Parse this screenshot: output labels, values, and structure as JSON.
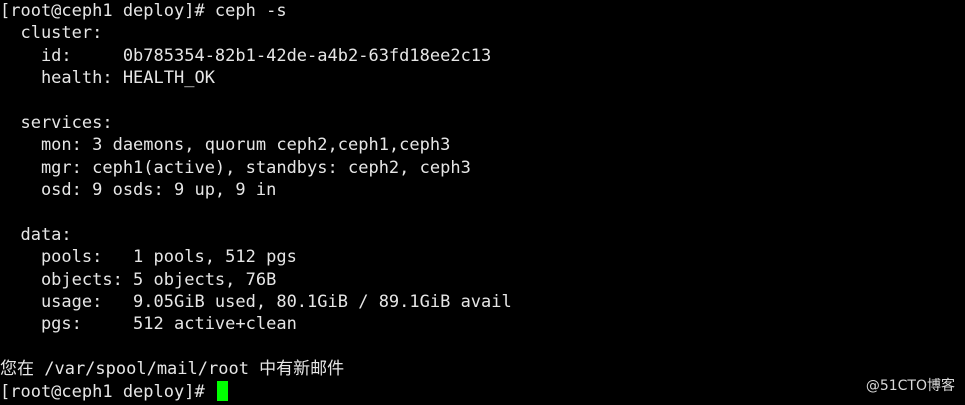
{
  "terminal": {
    "prompt_cmd": "[root@ceph1 deploy]# ceph -s",
    "cluster_header": "  cluster:",
    "cluster_id": "    id:     0b785354-82b1-42de-a4b2-63fd18ee2c13",
    "cluster_health": "    health: HEALTH_OK",
    "services_header": "  services:",
    "services_mon": "    mon: 3 daemons, quorum ceph2,ceph1,ceph3",
    "services_mgr": "    mgr: ceph1(active), standbys: ceph2, ceph3",
    "services_osd": "    osd: 9 osds: 9 up, 9 in",
    "data_header": "  data:",
    "data_pools": "    pools:   1 pools, 512 pgs",
    "data_objects": "    objects: 5 objects, 76B",
    "data_usage": "    usage:   9.05GiB used, 80.1GiB / 89.1GiB avail",
    "data_pgs": "    pgs:     512 active+clean",
    "mail_notice": "您在 /var/spool/mail/root 中有新邮件",
    "prompt_final": "[root@ceph1 deploy]# "
  },
  "watermark": "@51CTO博客",
  "colors": {
    "background": "#000000",
    "text": "#e6e6e6",
    "cursor": "#00ff00"
  }
}
